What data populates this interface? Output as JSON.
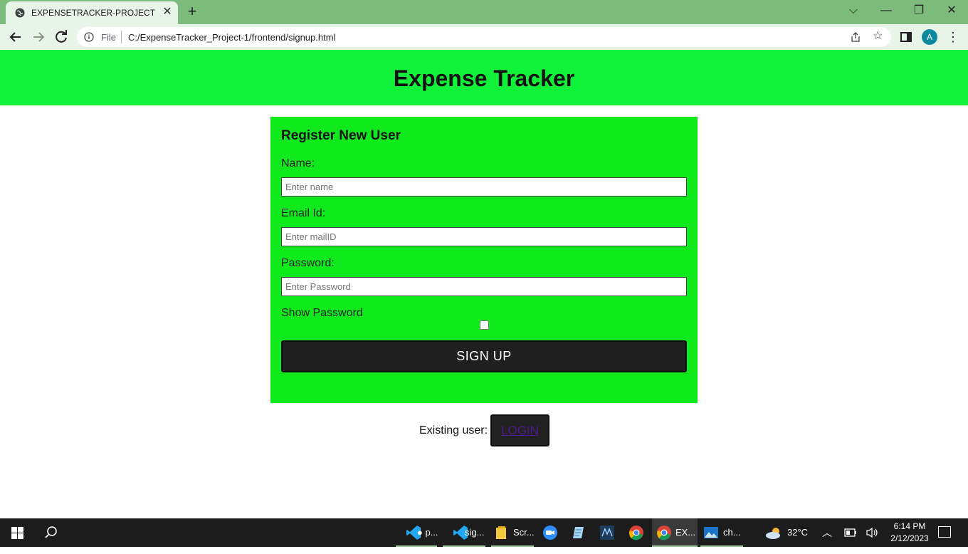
{
  "browser": {
    "tab_title": "EXPENSETRACKER-PROJECT",
    "address_scheme": "File",
    "address_url": "C:/ExpenseTracker_Project-1/frontend/signup.html",
    "profile_initial": "A",
    "frame_color": "#7dbb7d"
  },
  "page": {
    "header_title": "Expense Tracker",
    "header_color": "#10f239",
    "form": {
      "title": "Register New User",
      "name_label": "Name:",
      "name_placeholder": "Enter name",
      "email_label": "Email Id:",
      "email_placeholder": "Enter mailID",
      "password_label": "Password:",
      "password_placeholder": "Enter Password",
      "show_password_label": "Show Password",
      "show_password_checked": false,
      "signup_label": "SIGN UP",
      "panel_color": "#10ea1d"
    },
    "existing_user_text": "Existing user:",
    "login_label": "LOGIN"
  },
  "taskbar": {
    "apps": [
      {
        "name": "vscode",
        "label": "● p..."
      },
      {
        "name": "vscode",
        "label": "sig..."
      },
      {
        "name": "file-explorer",
        "label": "Scr..."
      },
      {
        "name": "zoom",
        "label": ""
      },
      {
        "name": "notepad",
        "label": ""
      },
      {
        "name": "mysql-workbench",
        "label": ""
      },
      {
        "name": "chrome",
        "label": ""
      },
      {
        "name": "chrome",
        "label": "EX..."
      },
      {
        "name": "photos",
        "label": "ch..."
      }
    ],
    "weather": "32°C",
    "time": "6:14 PM",
    "date": "2/12/2023"
  }
}
